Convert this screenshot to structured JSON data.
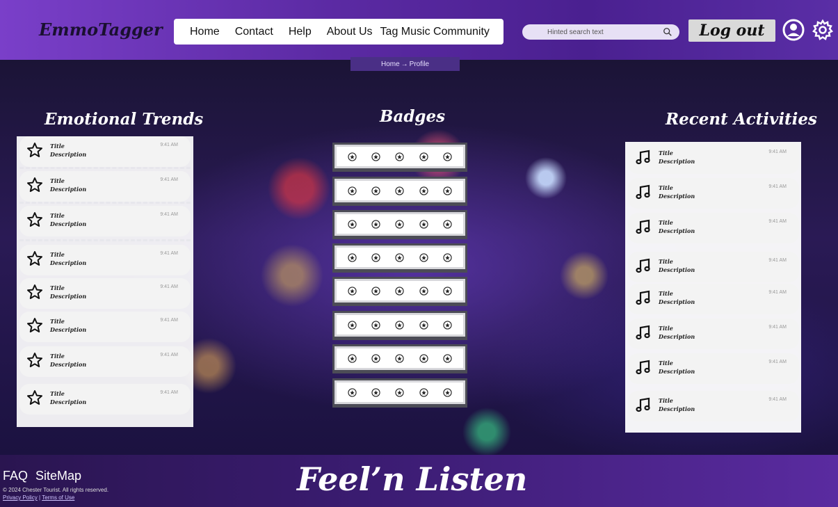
{
  "header": {
    "logo": "EmmoTagger",
    "nav": [
      "Home",
      "Contact",
      "Help",
      "About Us",
      "Tag Music Community"
    ],
    "search_placeholder": "Hinted search text",
    "logout_label": "Log out"
  },
  "breadcrumb": {
    "home": "Home",
    "sep": "→",
    "current": "Profile"
  },
  "sections": {
    "trends_title": "Emotional Trends",
    "badges_title": "Badges",
    "recent_title": "Recent Activities"
  },
  "trends": [
    {
      "title": "Title",
      "description": "Description",
      "time": "9:41 AM"
    },
    {
      "title": "Title",
      "description": "Description",
      "time": "9:41 AM"
    },
    {
      "title": "Title",
      "description": "Description",
      "time": "9:41 AM"
    },
    {
      "title": "Title",
      "description": "Description",
      "time": "9:41 AM"
    },
    {
      "title": "Title",
      "description": "Description",
      "time": "9:41 AM"
    },
    {
      "title": "Title",
      "description": "Description",
      "time": "9:41 AM"
    },
    {
      "title": "Title",
      "description": "Description",
      "time": "9:41 AM"
    },
    {
      "title": "Title",
      "description": "Description",
      "time": "9:41 AM"
    }
  ],
  "recent": [
    {
      "title": "Title",
      "description": "Description",
      "time": "9:41 AM"
    },
    {
      "title": "Title",
      "description": "Description",
      "time": "9:41 AM"
    },
    {
      "title": "Title",
      "description": "Description",
      "time": "9:41 AM"
    },
    {
      "title": "Title",
      "description": "Description",
      "time": "9:41 AM"
    },
    {
      "title": "Title",
      "description": "Description",
      "time": "9:41 AM"
    },
    {
      "title": "Title",
      "description": "Description",
      "time": "9:41 AM"
    },
    {
      "title": "Title",
      "description": "Description",
      "time": "9:41 AM"
    },
    {
      "title": "Title",
      "description": "Description",
      "time": "9:41 AM"
    }
  ],
  "badges": {
    "rows": 8,
    "per_row": 5,
    "icon": "star-badge-icon"
  },
  "footer": {
    "faq": "FAQ",
    "sitemap": "SiteMap",
    "copyright": "© 2024 Chester Tourist. All rights reserved.",
    "privacy": "Privacy Policy",
    "separator": "|",
    "terms": "Terms of Use",
    "brand": "Feel’n Listen"
  },
  "colors": {
    "header": "#5b2aa3",
    "footer": "#3b1c72",
    "accent": "#7a3fc9"
  }
}
